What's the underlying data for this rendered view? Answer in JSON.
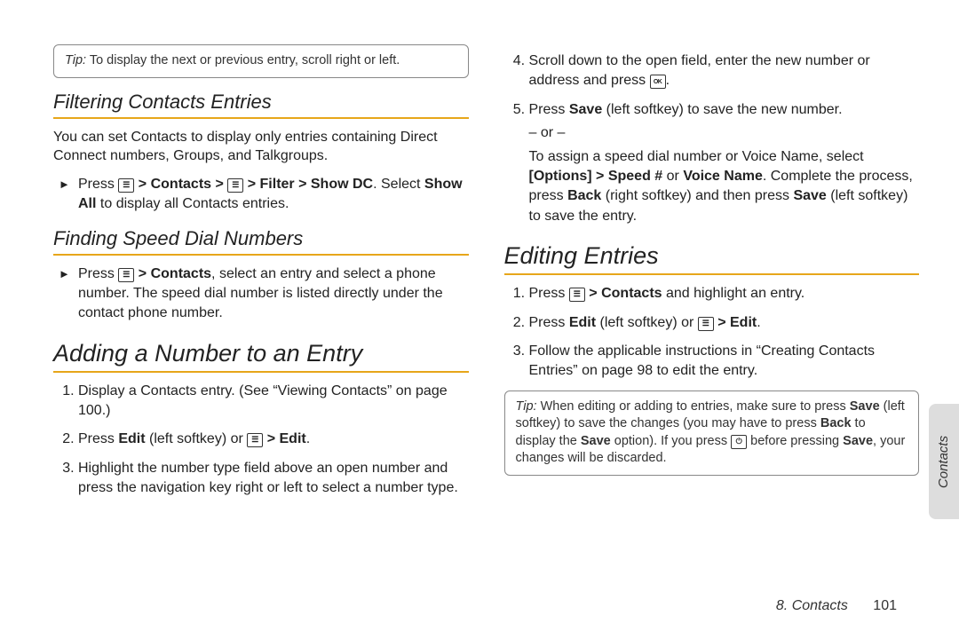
{
  "col1": {
    "tip1_label": "Tip:",
    "tip1_text": " To display the next or previous entry, scroll right or left.",
    "h_filter": "Filtering Contacts Entries",
    "filter_body": "You can set Contacts to display only entries containing Direct Connect numbers, Groups, and Talkgroups.",
    "filter_li_a": "Press ",
    "filter_li_b": " Contacts ",
    "filter_li_c": " Filter ",
    "filter_li_d": " Show DC",
    "filter_li_e": ". Select ",
    "filter_li_f": "Show All",
    "filter_li_g": " to display all Contacts entries.",
    "h_speed": "Finding Speed Dial Numbers",
    "speed_li_a": "Press ",
    "speed_li_b": " Contacts",
    "speed_li_c": ", select an entry and select a phone number. The speed dial number is listed directly under the contact phone number.",
    "h_add": "Adding a Number to an Entry",
    "add1": "Display a Contacts entry. (See “Viewing Contacts” on page 100.)",
    "add2_a": "Press ",
    "add2_b": "Edit",
    "add2_c": " (left softkey) or ",
    "add2_d": " Edit",
    "add2_e": ".",
    "add3": "Highlight the number type field above an open number and press the navigation key right or left to select a number type."
  },
  "col2": {
    "add4_a": "Scroll down to the open field, enter the new number or address and press ",
    "add4_b": ".",
    "add5_a": "Press ",
    "add5_b": "Save",
    "add5_c": " (left softkey) to save the new number.",
    "or_text": "– or –",
    "add5_d": "To assign a speed dial number or Voice Name, select ",
    "add5_e": "[Options] ",
    "add5_f": " Speed #",
    "add5_g": " or ",
    "add5_h": "Voice Name",
    "add5_i": ". Complete the process, press ",
    "add5_j": "Back",
    "add5_k": " (right softkey) and then press ",
    "add5_l": "Save",
    "add5_m": " (left softkey) to save the entry.",
    "h_edit": "Editing Entries",
    "edit1_a": "Press ",
    "edit1_b": " Contacts",
    "edit1_c": " and highlight an entry.",
    "edit2_a": "Press ",
    "edit2_b": "Edit",
    "edit2_c": " (left softkey) or ",
    "edit2_d": " Edit",
    "edit2_e": ".",
    "edit3": "Follow the applicable instructions in “Creating Contacts Entries” on page 98 to edit the entry.",
    "tip2_label": "Tip:",
    "tip2_a": " When editing or adding to entries, make sure to press ",
    "tip2_b": "Save",
    "tip2_c": " (left softkey) to save the changes (you may have to press ",
    "tip2_d": "Back",
    "tip2_e": " to display the ",
    "tip2_f": "Save",
    "tip2_g": " option). If you press ",
    "tip2_h": " before pressing ",
    "tip2_i": "Save",
    "tip2_j": ", your changes will be discarded."
  },
  "sidetab": "Contacts",
  "footer_section": "8. Contacts",
  "footer_page": "101",
  "gt": ">"
}
